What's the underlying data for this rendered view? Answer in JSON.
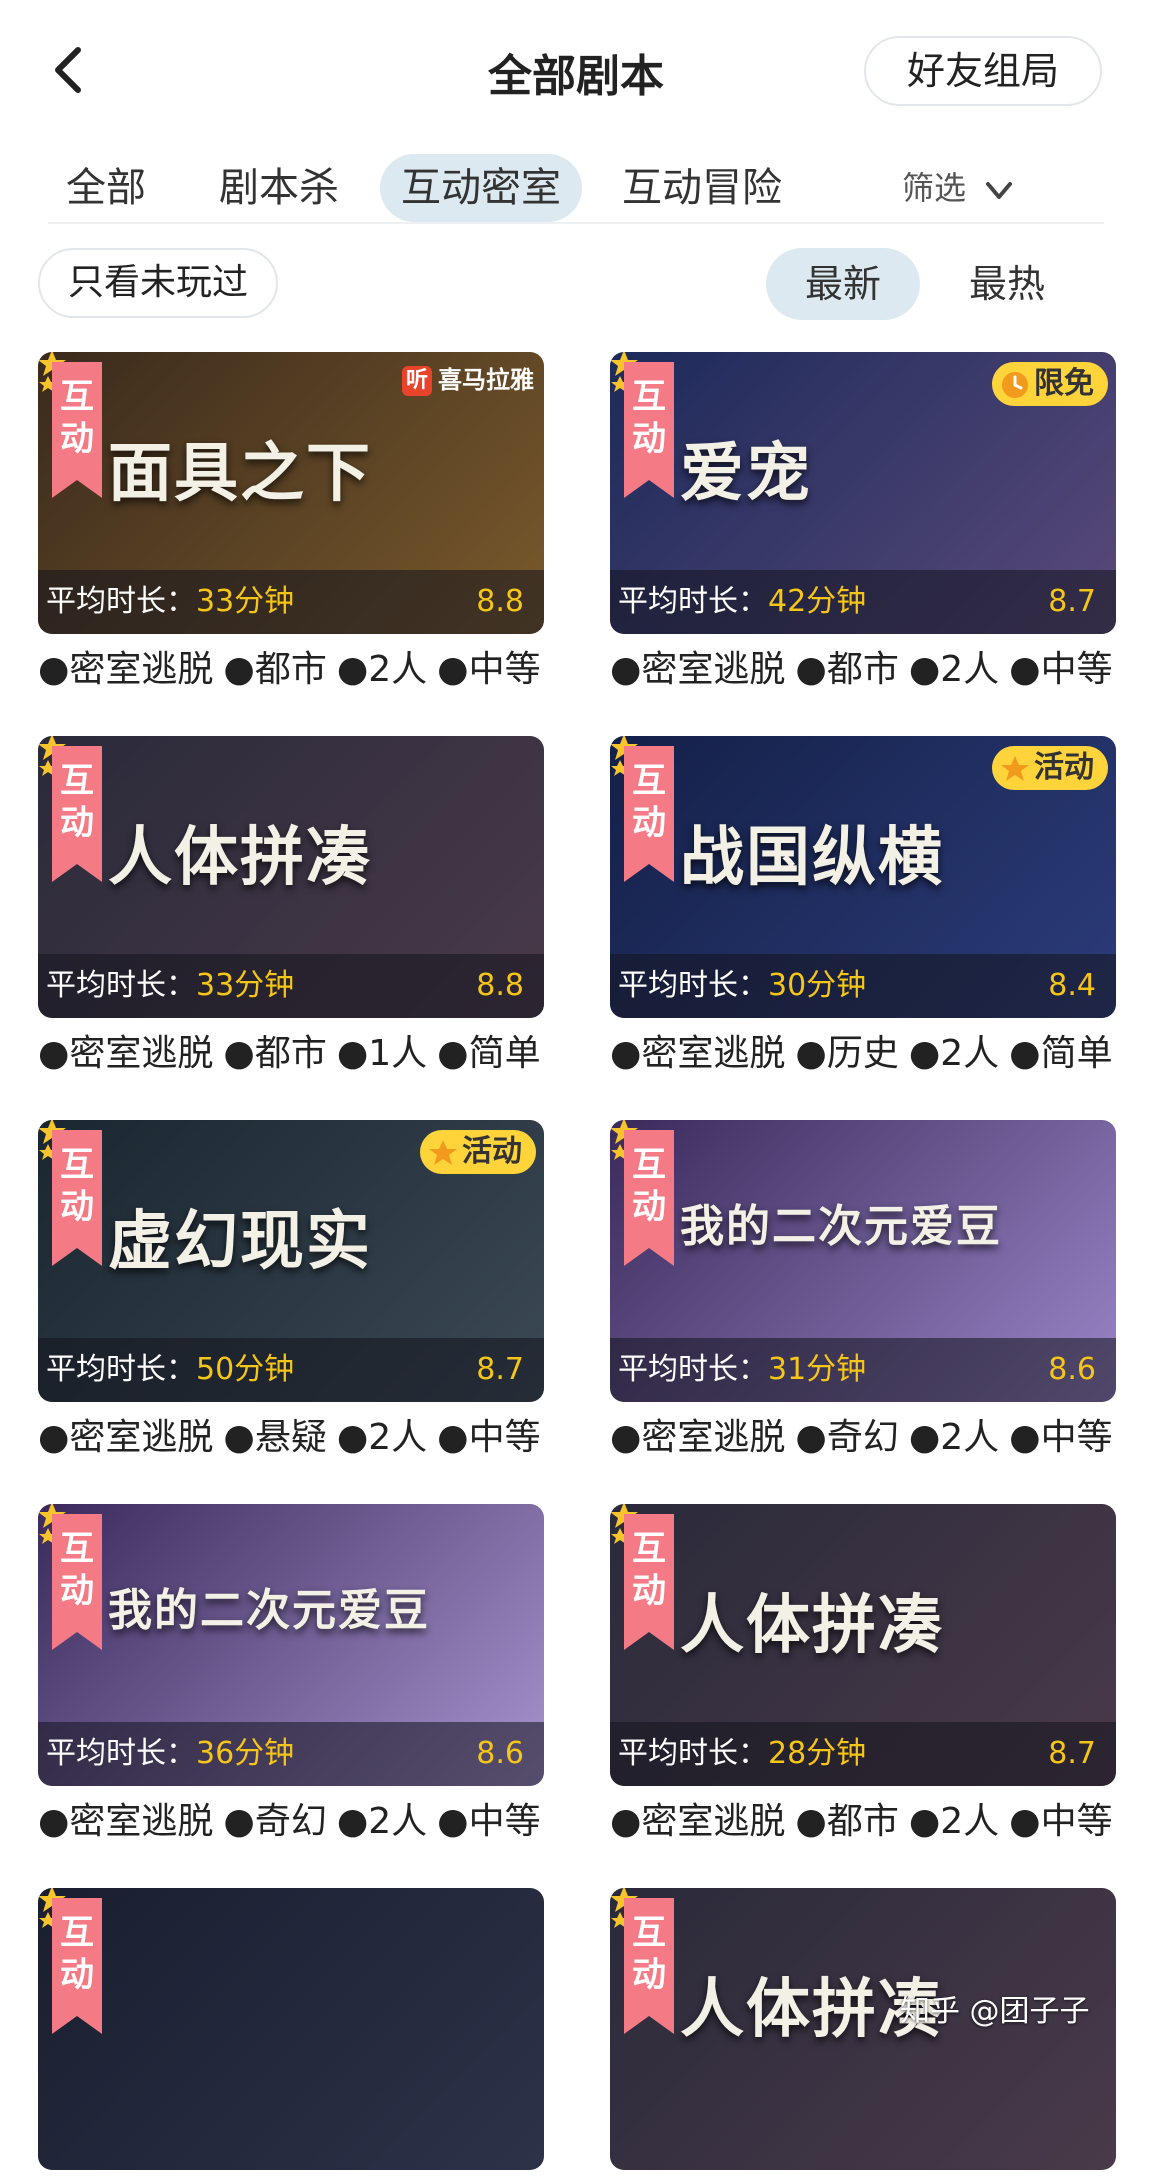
{
  "header": {
    "title": "全部剧本",
    "friend_button": "好友组局",
    "back_icon": "chevron-left-icon"
  },
  "tabs": [
    {
      "label": "全部",
      "active": false
    },
    {
      "label": "剧本杀",
      "active": false
    },
    {
      "label": "互动密室",
      "active": true
    },
    {
      "label": "互动冒险",
      "active": false
    }
  ],
  "filter": {
    "label": "筛选",
    "icon": "chevron-down-icon"
  },
  "toggle_unplayed": "只看未玩过",
  "sort": [
    {
      "label": "最新",
      "active": true
    },
    {
      "label": "最热",
      "active": false
    }
  ],
  "common": {
    "ribbon": "互动",
    "duration_label": "平均时长："
  },
  "cards": [
    {
      "cover_title": "面具之下",
      "brand": "喜马拉雅",
      "brand_icon": "听",
      "badge": "",
      "duration": "33分钟",
      "rating": "8.8",
      "tags": [
        "●密室逃脱",
        "●都市",
        "●2人",
        "●中等"
      ],
      "colors": [
        "#3a2a1c",
        "#7a5a2c"
      ]
    },
    {
      "cover_title": "爱宠",
      "brand": "",
      "badge": "限免",
      "badge_icon": "clock-icon",
      "duration": "42分钟",
      "rating": "8.7",
      "tags": [
        "●密室逃脱",
        "●都市",
        "●2人",
        "●中等"
      ],
      "colors": [
        "#1c2a5a",
        "#5a4a7a"
      ]
    },
    {
      "cover_title": "人体拼凑",
      "brand": "",
      "badge": "",
      "duration": "33分钟",
      "rating": "8.8",
      "tags": [
        "●密室逃脱",
        "●都市",
        "●1人",
        "●简单"
      ],
      "colors": [
        "#2a2a3a",
        "#4a3a4a"
      ]
    },
    {
      "cover_title": "战国纵横",
      "brand": "",
      "badge": "活动",
      "badge_icon": "star-icon",
      "duration": "30分钟",
      "rating": "8.4",
      "tags": [
        "●密室逃脱",
        "●历史",
        "●2人",
        "●简单"
      ],
      "colors": [
        "#142048",
        "#2c3c7a"
      ]
    },
    {
      "cover_title": "虚幻现实",
      "brand": "",
      "badge": "活动",
      "badge_icon": "star-icon",
      "duration": "50分钟",
      "rating": "8.7",
      "tags": [
        "●密室逃脱",
        "●悬疑",
        "●2人",
        "●中等"
      ],
      "colors": [
        "#1a2630",
        "#3c4a56"
      ]
    },
    {
      "cover_title": "我的二次元爱豆",
      "brand": "",
      "badge": "",
      "duration": "31分钟",
      "rating": "8.6",
      "tags": [
        "●密室逃脱",
        "●奇幻",
        "●2人",
        "●中等"
      ],
      "colors": [
        "#3a2a5a",
        "#9a86c8"
      ]
    },
    {
      "cover_title": "我的二次元爱豆",
      "brand": "",
      "badge": "",
      "duration": "36分钟",
      "rating": "8.6",
      "tags": [
        "●密室逃脱",
        "●奇幻",
        "●2人",
        "●中等"
      ],
      "colors": [
        "#3a2a5a",
        "#a894d0"
      ]
    },
    {
      "cover_title": "人体拼凑",
      "brand": "",
      "badge": "",
      "duration": "28分钟",
      "rating": "8.7",
      "tags": [
        "●密室逃脱",
        "●都市",
        "●2人",
        "●中等"
      ],
      "colors": [
        "#2a2a3a",
        "#4a3a4a"
      ]
    },
    {
      "cover_title": "",
      "brand": "",
      "badge": "",
      "duration": "",
      "rating": "",
      "tags": [],
      "colors": [
        "#1a1e30",
        "#2c3248"
      ]
    },
    {
      "cover_title": "人体拼凑",
      "brand": "",
      "badge": "",
      "duration": "",
      "rating": "",
      "tags": [],
      "colors": [
        "#2a2a3a",
        "#4a3a4a"
      ]
    }
  ],
  "watermark": "知乎 @团子子"
}
